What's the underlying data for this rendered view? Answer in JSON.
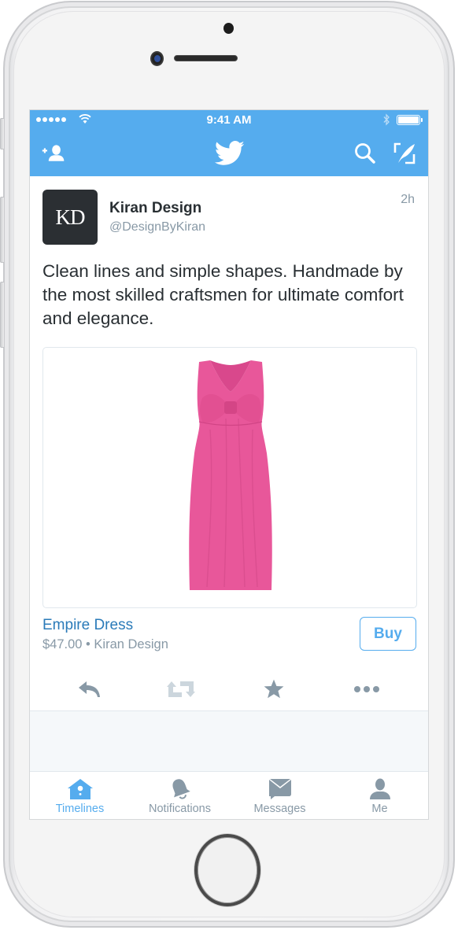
{
  "device": {
    "type": "phone-frame"
  },
  "status_bar": {
    "time": "9:41 AM",
    "signal_bars": 5,
    "wifi": true,
    "bluetooth": true,
    "battery_level": 1.0
  },
  "nav_bar": {
    "left_icon": "add-user-icon",
    "center_icon": "twitter-bird-icon",
    "right_icons": [
      "search-icon",
      "compose-tweet-icon"
    ],
    "color": "#55acee"
  },
  "tweet": {
    "avatar_initials": "KD",
    "author_name": "Kiran Design",
    "author_handle": "@DesignByKiran",
    "time_ago": "2h",
    "text": "Clean lines and simple shapes. Handmade by the most skilled craftsmen for ultimate comfort and elegance.",
    "product": {
      "image_alt": "Pink sleeveless empire dress with bow",
      "title": "Empire Dress",
      "meta": "$47.00 • Kiran Design",
      "price": "$47.00",
      "seller": "Kiran Design",
      "buy_label": "Buy",
      "dress_color": "#e8579a"
    },
    "actions": [
      {
        "name": "reply",
        "icon": "reply-icon"
      },
      {
        "name": "retweet",
        "icon": "retweet-icon",
        "disabled": true
      },
      {
        "name": "favorite",
        "icon": "star-icon"
      },
      {
        "name": "more",
        "icon": "more-icon"
      }
    ]
  },
  "tab_bar": {
    "tabs": [
      {
        "label": "Timelines",
        "icon": "home-birdhouse-icon",
        "active": true
      },
      {
        "label": "Notifications",
        "icon": "bell-icon",
        "active": false
      },
      {
        "label": "Messages",
        "icon": "envelope-icon",
        "active": false
      },
      {
        "label": "Me",
        "icon": "person-icon",
        "active": false
      }
    ],
    "active_color": "#55acee",
    "inactive_color": "#8899a6"
  }
}
